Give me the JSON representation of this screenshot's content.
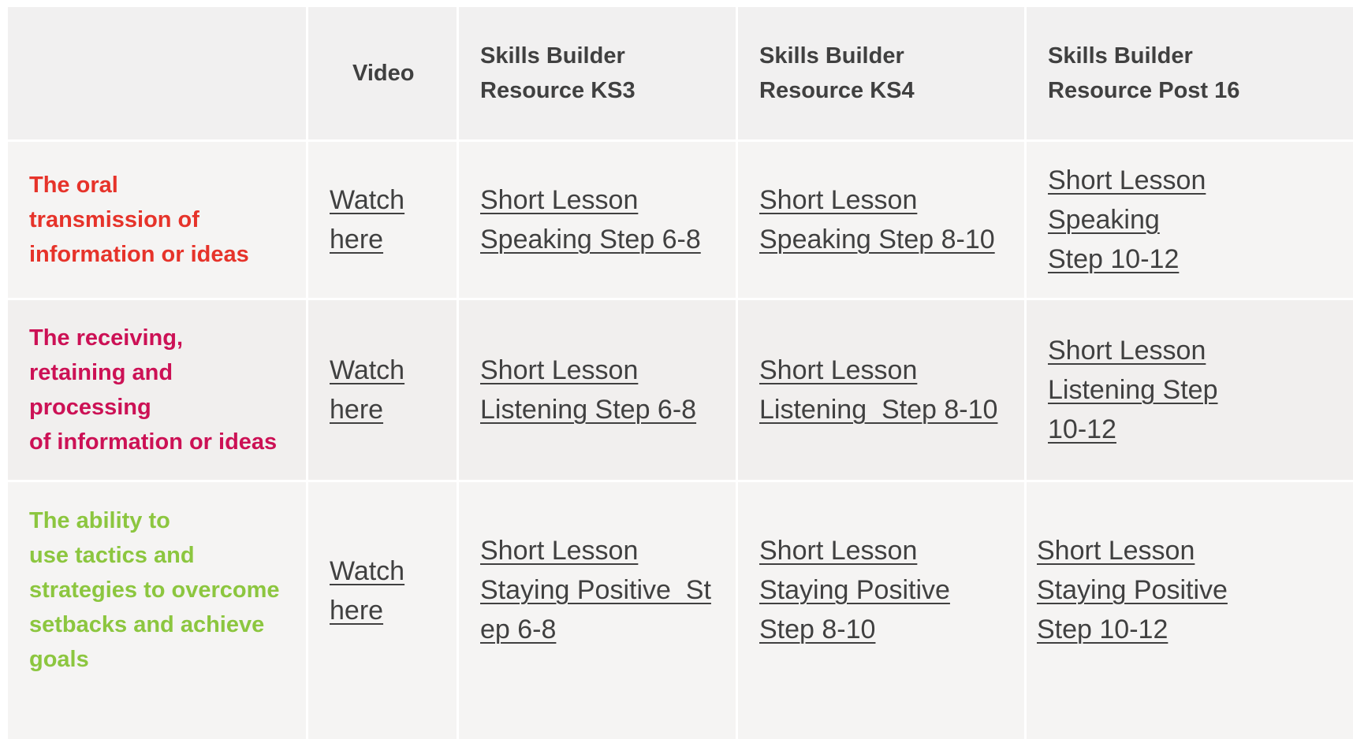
{
  "header": {
    "col1": "",
    "col2": "Video",
    "col3": [
      "Skills Builder",
      "Resource KS3"
    ],
    "col4": [
      "Skills Builder",
      "Resource KS4"
    ],
    "col5": [
      "Skills Builder",
      "Resource Post 16"
    ]
  },
  "rows": [
    {
      "label": [
        "The oral",
        "transmission of",
        "information or ideas"
      ],
      "label_color": "#e6332a",
      "video": [
        "Watch",
        "here"
      ],
      "ks3": [
        "Short Lesson",
        "Speaking Step 6-8"
      ],
      "ks4": [
        "Short Lesson",
        "Speaking Step 8-10"
      ],
      "post16": [
        "Short Lesson",
        "Speaking",
        "Step 10-12"
      ]
    },
    {
      "label": [
        "The receiving,",
        "retaining and",
        "processing",
        "of information or ideas"
      ],
      "label_color": "#cc1155",
      "video": [
        "Watch",
        "here"
      ],
      "ks3": [
        "Short Lesson",
        "Listening Step 6-8"
      ],
      "ks4": [
        "Short Lesson",
        "Listening  Step 8-10"
      ],
      "post16": [
        "Short Lesson",
        "Listening Step",
        "10-12"
      ]
    },
    {
      "label": [
        "The ability to",
        "use tactics and",
        "strategies to overcome",
        "setbacks and achieve",
        "goals"
      ],
      "label_color": "#8cc63f",
      "video": [
        "Watch",
        "here"
      ],
      "ks3": [
        "Short Lesson",
        "Staying Positive  St",
        "ep 6-8"
      ],
      "ks4": [
        "Short Lesson",
        "Staying Positive",
        "Step 8-10"
      ],
      "post16": [
        "Short Lesson",
        "Staying Positive",
        "Step 10-12"
      ]
    }
  ],
  "colors": {
    "header_bg": "#f1f0f0",
    "row_bg_light": "#f5f4f3",
    "row_bg_dark": "#f1efee",
    "text": "#404040"
  }
}
